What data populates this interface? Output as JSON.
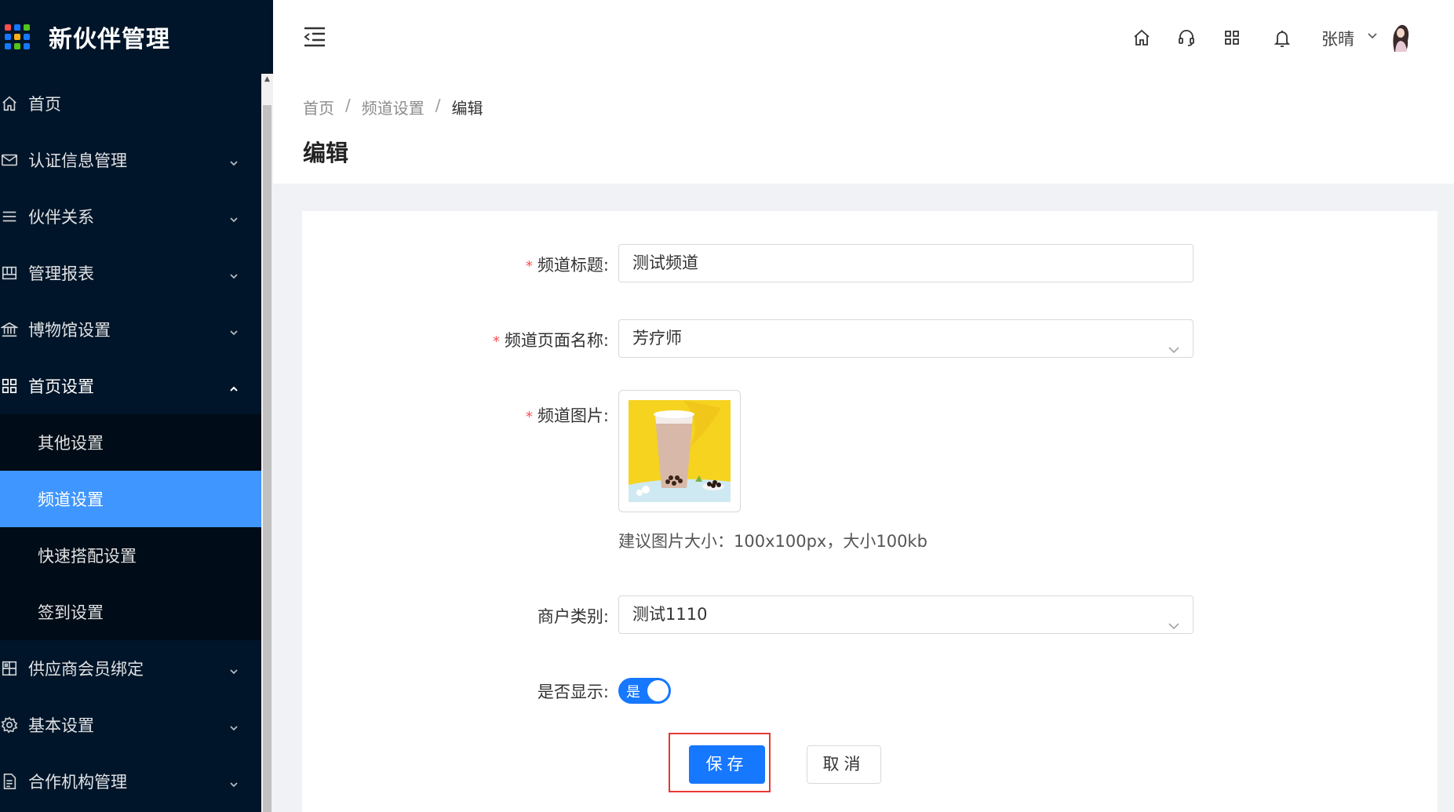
{
  "app": {
    "title": "新伙伴管理",
    "logo_colors": [
      "#ff4d4f",
      "#1677ff",
      "#52c41a",
      "#1677ff",
      "#faad14",
      "#1677ff",
      "#1677ff",
      "#52c41a",
      "#1677ff"
    ]
  },
  "sidebar": {
    "items": [
      {
        "label": "首页",
        "icon": "home-icon",
        "has_arrow": false
      },
      {
        "label": "认证信息管理",
        "icon": "mail-icon",
        "has_arrow": true
      },
      {
        "label": "伙伴关系",
        "icon": "list-icon",
        "has_arrow": true
      },
      {
        "label": "管理报表",
        "icon": "report-icon",
        "has_arrow": true
      },
      {
        "label": "博物馆设置",
        "icon": "bank-icon",
        "has_arrow": true
      },
      {
        "label": "首页设置",
        "icon": "appstore-icon",
        "has_arrow": true,
        "open": true
      },
      {
        "label": "供应商会员绑定",
        "icon": "scan-icon",
        "has_arrow": true
      },
      {
        "label": "基本设置",
        "icon": "setting-icon",
        "has_arrow": true
      },
      {
        "label": "合作机构管理",
        "icon": "file-icon",
        "has_arrow": true
      }
    ],
    "submenu": [
      {
        "label": "其他设置",
        "active": false
      },
      {
        "label": "频道设置",
        "active": true
      },
      {
        "label": "快速搭配设置",
        "active": false
      },
      {
        "label": "签到设置",
        "active": false
      }
    ]
  },
  "header": {
    "username": "张晴"
  },
  "breadcrumb": {
    "home": "首页",
    "parent": "频道设置",
    "current": "编辑",
    "separator": "/"
  },
  "page": {
    "title": "编辑"
  },
  "form": {
    "channel_title": {
      "label": "频道标题:",
      "value": "测试频道",
      "required": true
    },
    "page_name": {
      "label": "频道页面名称:",
      "value": "芳疗师",
      "required": true
    },
    "image": {
      "label": "频道图片:",
      "required": true,
      "hint": "建议图片大小：100x100px，大小100kb"
    },
    "merchant_type": {
      "label": "商户类别:",
      "value": "测试1110",
      "required": false
    },
    "display": {
      "label": "是否显示:",
      "value": "是",
      "on": true
    },
    "required_mark": "*"
  },
  "buttons": {
    "save": "保存",
    "cancel": "取消"
  },
  "colors": {
    "sidebar_bg": "#001529",
    "submenu_bg": "#000c17",
    "primary": "#1677ff",
    "active_item": "#4096ff",
    "highlight_border": "#e53935",
    "required": "#ff4d4f"
  }
}
